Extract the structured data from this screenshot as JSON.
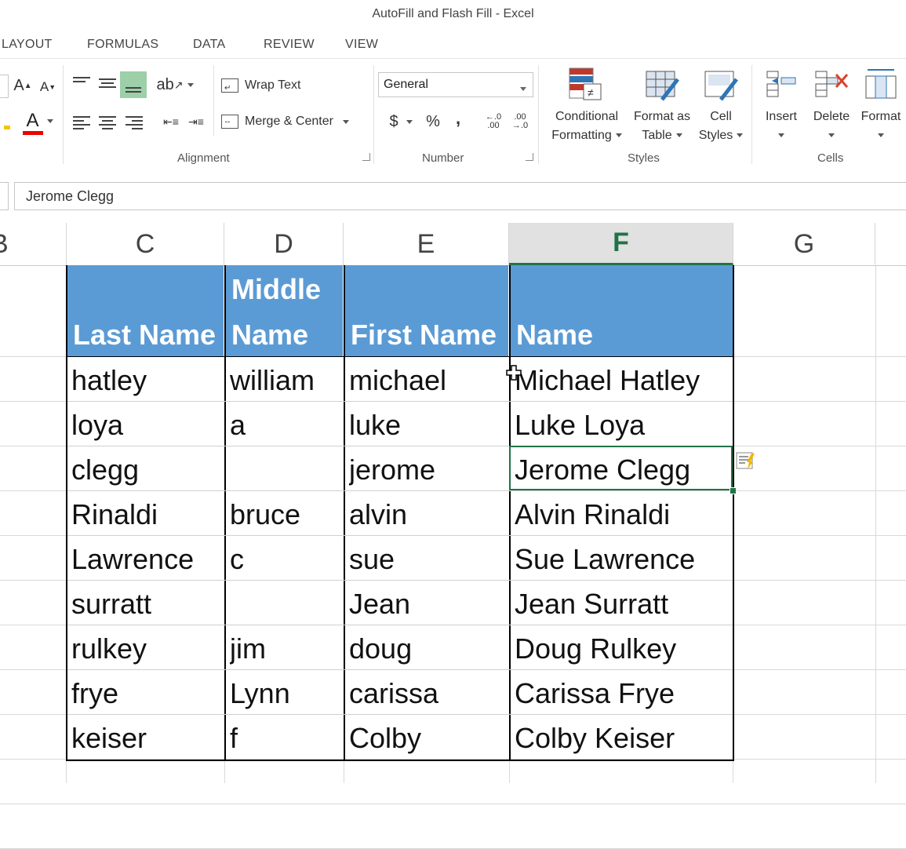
{
  "window": {
    "title": "AutoFill and Flash Fill - Excel"
  },
  "ribbon_tabs": [
    "LAYOUT",
    "FORMULAS",
    "DATA",
    "REVIEW",
    "VIEW"
  ],
  "ribbon": {
    "alignment": {
      "wrap_text": "Wrap Text",
      "merge_center": "Merge & Center",
      "label": "Alignment"
    },
    "number": {
      "format": "General",
      "currency": "$",
      "percent": "%",
      "comma": ",",
      "label": "Number"
    },
    "styles": {
      "conditional_formatting": [
        "Conditional",
        "Formatting"
      ],
      "format_as_table": [
        "Format as",
        "Table"
      ],
      "cell_styles": [
        "Cell",
        "Styles"
      ],
      "label": "Styles"
    },
    "cells": {
      "insert": "Insert",
      "delete": "Delete",
      "format": "Format",
      "label": "Cells"
    },
    "font": {
      "grow": "A",
      "shrink": "A",
      "font_color": "A"
    }
  },
  "formula_bar": {
    "value": "Jerome Clegg"
  },
  "columns": [
    "B",
    "C",
    "D",
    "E",
    "F",
    "G"
  ],
  "selected_column": "F",
  "table": {
    "headers": [
      [
        "",
        "Last Name"
      ],
      [
        "Middle",
        "Name"
      ],
      [
        "",
        "First Name"
      ],
      [
        "",
        "Name"
      ]
    ],
    "rows": [
      [
        "hatley",
        "william",
        "michael",
        "Michael Hatley"
      ],
      [
        "loya",
        "a",
        "luke",
        "Luke Loya"
      ],
      [
        "clegg",
        "",
        "jerome",
        "Jerome Clegg"
      ],
      [
        "Rinaldi",
        "bruce",
        "alvin",
        "Alvin Rinaldi"
      ],
      [
        "Lawrence",
        "c",
        "sue",
        "Sue Lawrence"
      ],
      [
        "surratt",
        "",
        "Jean",
        "Jean Surratt"
      ],
      [
        "rulkey",
        "jim",
        "doug",
        "Doug Rulkey"
      ],
      [
        "frye",
        "Lynn",
        "carissa",
        "Carissa Frye"
      ],
      [
        "keiser",
        "f",
        "Colby",
        "Colby Keiser"
      ]
    ]
  },
  "colors": {
    "header_fill": "#5b9bd5",
    "excel_green": "#217346"
  }
}
